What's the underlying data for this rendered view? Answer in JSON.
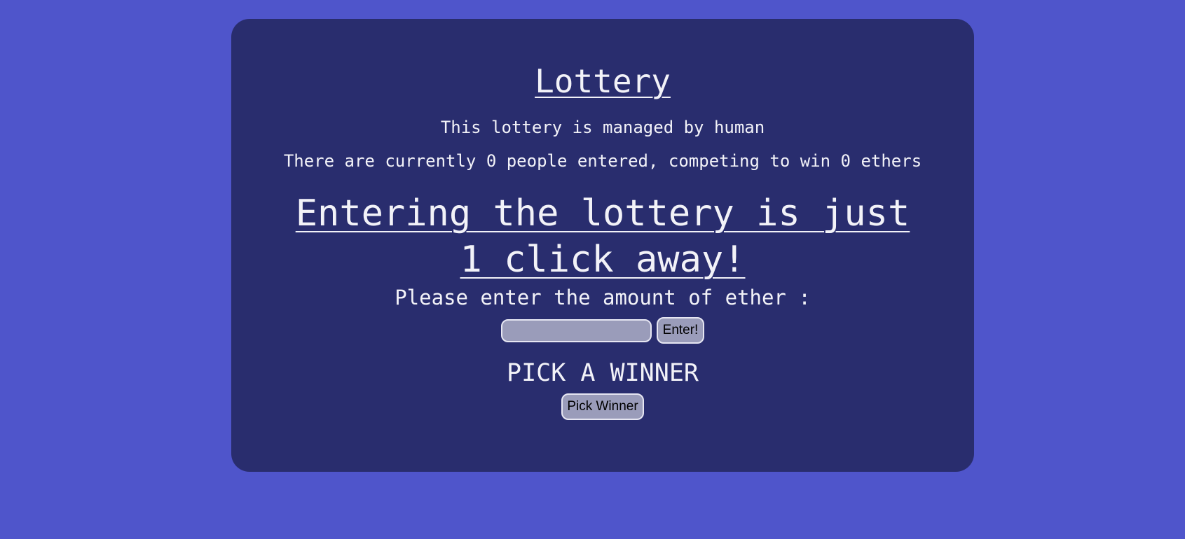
{
  "lottery": {
    "title": "Lottery",
    "manager_text": "This lottery is managed by human",
    "stats": {
      "prefix": "There are currently ",
      "players": "0",
      "middle": " people entered, competing to win ",
      "prize": "0",
      "suffix": " ethers"
    }
  },
  "entry": {
    "headline": "Entering the lottery is just 1 click away!",
    "prompt": "Please enter the amount of ether :",
    "amount_value": "",
    "amount_placeholder": "",
    "enter_label": "Enter!"
  },
  "pick": {
    "heading": "PICK A WINNER",
    "button_label": "Pick Winner"
  },
  "colors": {
    "page_background": "#4f55cb",
    "card_background": "#292d6e",
    "control_background": "#9a9cba",
    "text": "#f2f2f8"
  }
}
